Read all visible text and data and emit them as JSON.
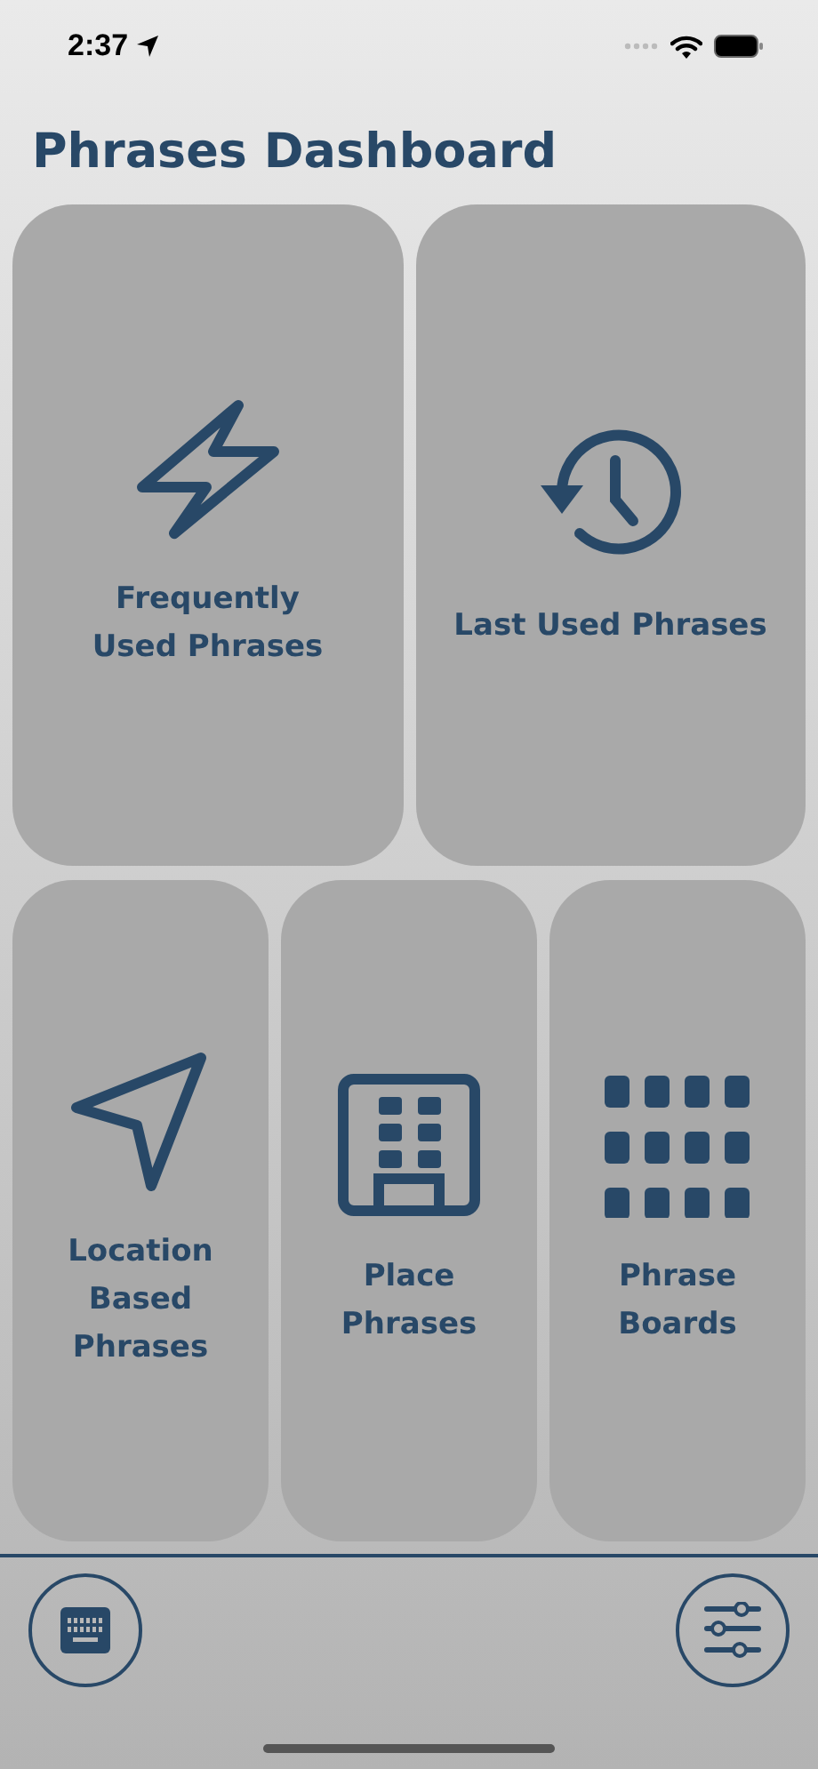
{
  "status_bar": {
    "time": "2:37"
  },
  "title": "Phrases Dashboard",
  "tiles_top": [
    {
      "kind": "bolt",
      "label": "Frequently\nUsed Phrases"
    },
    {
      "kind": "history",
      "label": "Last Used Phrases"
    }
  ],
  "tiles_bottom": [
    {
      "kind": "location",
      "label": "Location\nBased\nPhrases"
    },
    {
      "kind": "building",
      "label": "Place\nPhrases"
    },
    {
      "kind": "grid",
      "label": "Phrase\nBoards"
    }
  ],
  "toolbar": [
    {
      "kind": "keyboard"
    },
    {
      "kind": "sliders"
    }
  ]
}
